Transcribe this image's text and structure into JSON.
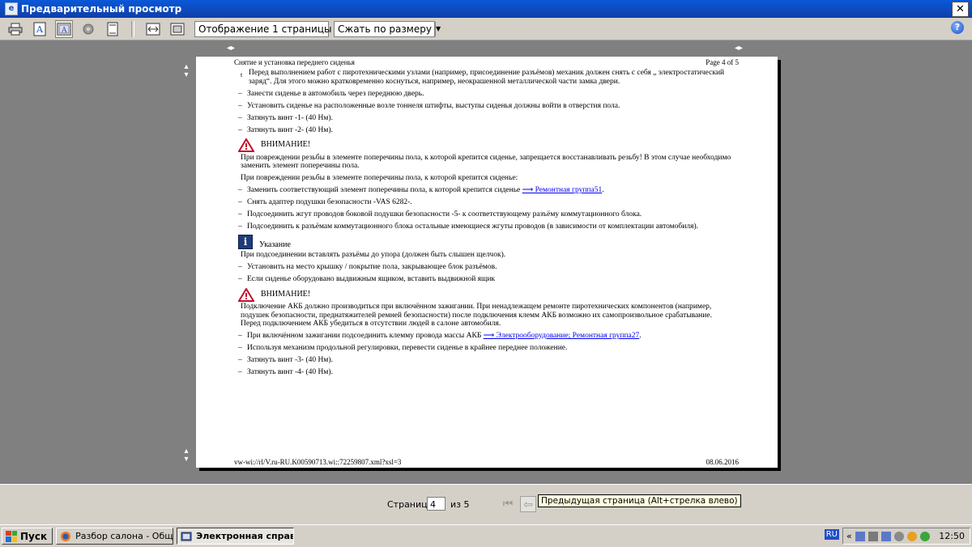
{
  "window": {
    "title": "Предварительный просмотр",
    "close_glyph": "✕"
  },
  "toolbar": {
    "buttons": [
      "print-icon",
      "adjust-frames-icon",
      "single-frame-icon",
      "page-setup-icon",
      "header-footer-icon",
      "full-width-icon",
      "full-page-icon"
    ],
    "view_select": "Отображение 1 страницы",
    "zoom_select": "Сжать по размеру",
    "help_glyph": "?"
  },
  "page": {
    "header_left": "Снятие и установка переднего сиденья",
    "header_right": "Page 4 of 5",
    "footer_left": "vw-wi://rl/V.ru-RU.K00590713.wi::72259807.xml?xsl=3",
    "footer_right": "08.06.2016",
    "intro_mark": "t",
    "intro": "Перед выполнением работ с пиротехническими узлами (например, присоединение разъёмов) механик должен снять с себя „ электростатический заряд“. Для этого можно кратковременно коснуться, например, неокрашенной металлической части замка двери.",
    "steps1": [
      "Занести сиденье в автомобиль через переднюю дверь.",
      "Установить сиденье на расположенные возле тоннеля штифты, выступы сиденья должны войти в отверстия пола.",
      "Затянуть винт -1- (40 Нм).",
      "Затянуть винт -2- (40 Нм)."
    ],
    "warning1_label": "ВНИМАНИЕ!",
    "warning1_text": "При повреждении резьбы в элементе поперечины пола, к которой крепится сиденье, запрещается восстанавливать резьбу! В этом случае необходимо заменить элемент поперечины пола.",
    "damage_intro": "При повреждении резьбы в элементе поперечины пола, к которой крепится сиденье:",
    "replace_step": "Заменить соответствующий элемент поперечины пола, к которой крепится сиденье",
    "replace_link": "⟶ Ремонтная группа51",
    "replace_tail": ".",
    "steps2": [
      "Снять адаптер подушки безопасности -VAS 6282-.",
      "Подсоединить жгут проводов боковой подушки безопасности -5- к соответствующему разъёму коммутационного блока.",
      "Подсоединить к разъёмам коммутационного блока остальные имеющиеся жгуты проводов (в зависимости от комплектации автомобиля)."
    ],
    "note_glyph": "i",
    "note_label": "Указание",
    "note_text": "При подсоединении вставлять разъёмы до упора (должен быть слышен щелчок).",
    "steps3": [
      "Установить на место крышку / покрытие пола, закрывающее блок разъёмов.",
      "Если сиденье оборудовано выдвижным ящиком, вставить выдвижной ящик"
    ],
    "warning2_label": "ВНИМАНИЕ!",
    "warning2_text": "Подключение АКБ должно производиться при включённом зажигании. При ненадлежащем ремонте пиротехнических компонентов (например, подушек безопасности, преднатяжителей ремней безопасности) после подключения клемм АКБ возможно их самопроизвольное срабатывание. Перед подключением АКБ убедиться в отсутствии людей в салоне автомобиля.",
    "battery_step": "При включённом зажигании подсоединить клемму провода массы АКБ",
    "battery_link": "⟶ Электрооборудование; Ремонтная группа27",
    "battery_tail": ".",
    "steps4": [
      "Используя механизм продольной регулировки, перевести сиденье в крайнее переднее положение.",
      "Затянуть винт -3- (40 Нм).",
      "Затянуть винт -4- (40 Нм)."
    ]
  },
  "pager": {
    "label": "Страница",
    "current": "4",
    "of": "из 5",
    "first_glyph": "⏮",
    "prev_glyph": "⇦",
    "tooltip": "Предыдущая страница (Alt+стрелка влево)"
  },
  "taskbar": {
    "start": "Пуск",
    "tasks": [
      "Разбор салона - Общие...",
      "Электронная справо..."
    ],
    "lang": "RU",
    "tray_chevron": "«",
    "clock": "12:50"
  }
}
